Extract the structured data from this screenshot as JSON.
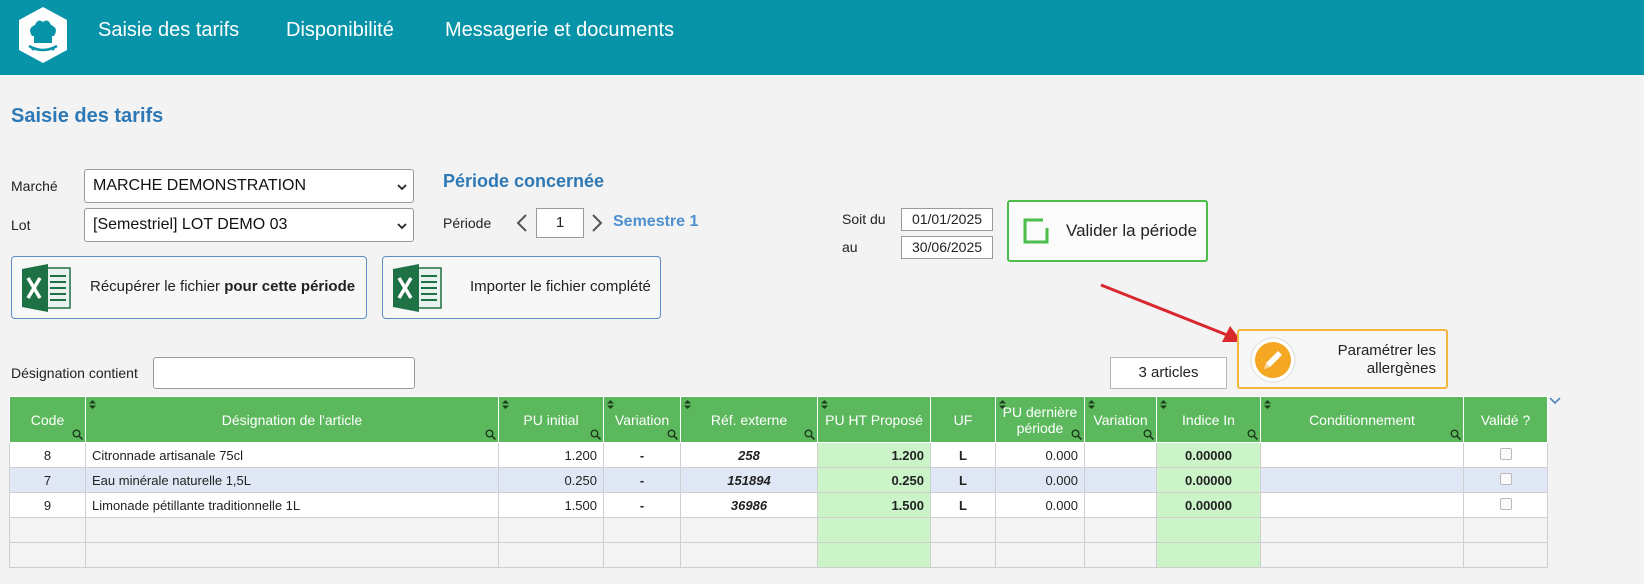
{
  "nav": {
    "items": [
      "Saisie des tarifs",
      "Disponibilité",
      "Messagerie et documents"
    ]
  },
  "page": {
    "title": "Saisie des tarifs"
  },
  "form": {
    "marche_label": "Marché",
    "marche_value": "MARCHE DEMONSTRATION",
    "lot_label": "Lot",
    "lot_value": "[Semestriel] LOT DEMO 03",
    "periode_title": "Période concernée",
    "periode_label": "Période",
    "periode_value": "1",
    "semestre": "Semestre 1",
    "soit_du_label": "Soit du",
    "date_from": "01/01/2025",
    "au_label": "au",
    "date_to": "30/06/2025",
    "valider_label": "Valider la période"
  },
  "buttons": {
    "recuperer_prefix": "Récupérer le fichier ",
    "recuperer_bold": "pour cette période",
    "importer": "Importer le fichier complété",
    "allergenes": "Paramétrer les allergènes"
  },
  "filter": {
    "label": "Désignation contient",
    "value": "",
    "count": "3 articles"
  },
  "table": {
    "headers": [
      "Code",
      "Désignation de l'article",
      "PU initial",
      "Variation",
      "Réf. externe",
      "PU HT Proposé",
      "UF",
      "PU dernière période",
      "Variation",
      "Indice In",
      "Conditionnement",
      "Validé ?"
    ],
    "rows": [
      {
        "code": "8",
        "designation": "Citronnade artisanale 75cl",
        "pu_initial": "1.200",
        "variation": "-",
        "ref_externe": "258",
        "pu_propose": "1.200",
        "uf": "L",
        "pu_derniere": "0.000",
        "variation2": "",
        "indice": "0.00000",
        "conditionnement": ""
      },
      {
        "code": "7",
        "designation": "Eau minérale naturelle 1,5L",
        "pu_initial": "0.250",
        "variation": "-",
        "ref_externe": "151894",
        "pu_propose": "0.250",
        "uf": "L",
        "pu_derniere": "0.000",
        "variation2": "",
        "indice": "0.00000",
        "conditionnement": ""
      },
      {
        "code": "9",
        "designation": "Limonade pétillante traditionnelle 1L",
        "pu_initial": "1.500",
        "variation": "-",
        "ref_externe": "36986",
        "pu_propose": "1.500",
        "uf": "L",
        "pu_derniere": "0.000",
        "variation2": "",
        "indice": "0.00000",
        "conditionnement": ""
      }
    ]
  },
  "colors": {
    "topbar": "#0794a8",
    "title_blue": "#2d78b5",
    "header_green": "#5cb85c",
    "input_green": "#cbf5c9",
    "valider_border": "#4bbd4b",
    "allergen_border": "#f3b63f",
    "annotation_red": "#d9272e"
  },
  "icons": [
    "chef-hat-logo-icon",
    "chevron-down-icon",
    "chevron-left-icon",
    "chevron-right-icon",
    "checkbox-square-icon",
    "excel-icon",
    "pencil-icon",
    "sort-icon",
    "search-icon"
  ]
}
